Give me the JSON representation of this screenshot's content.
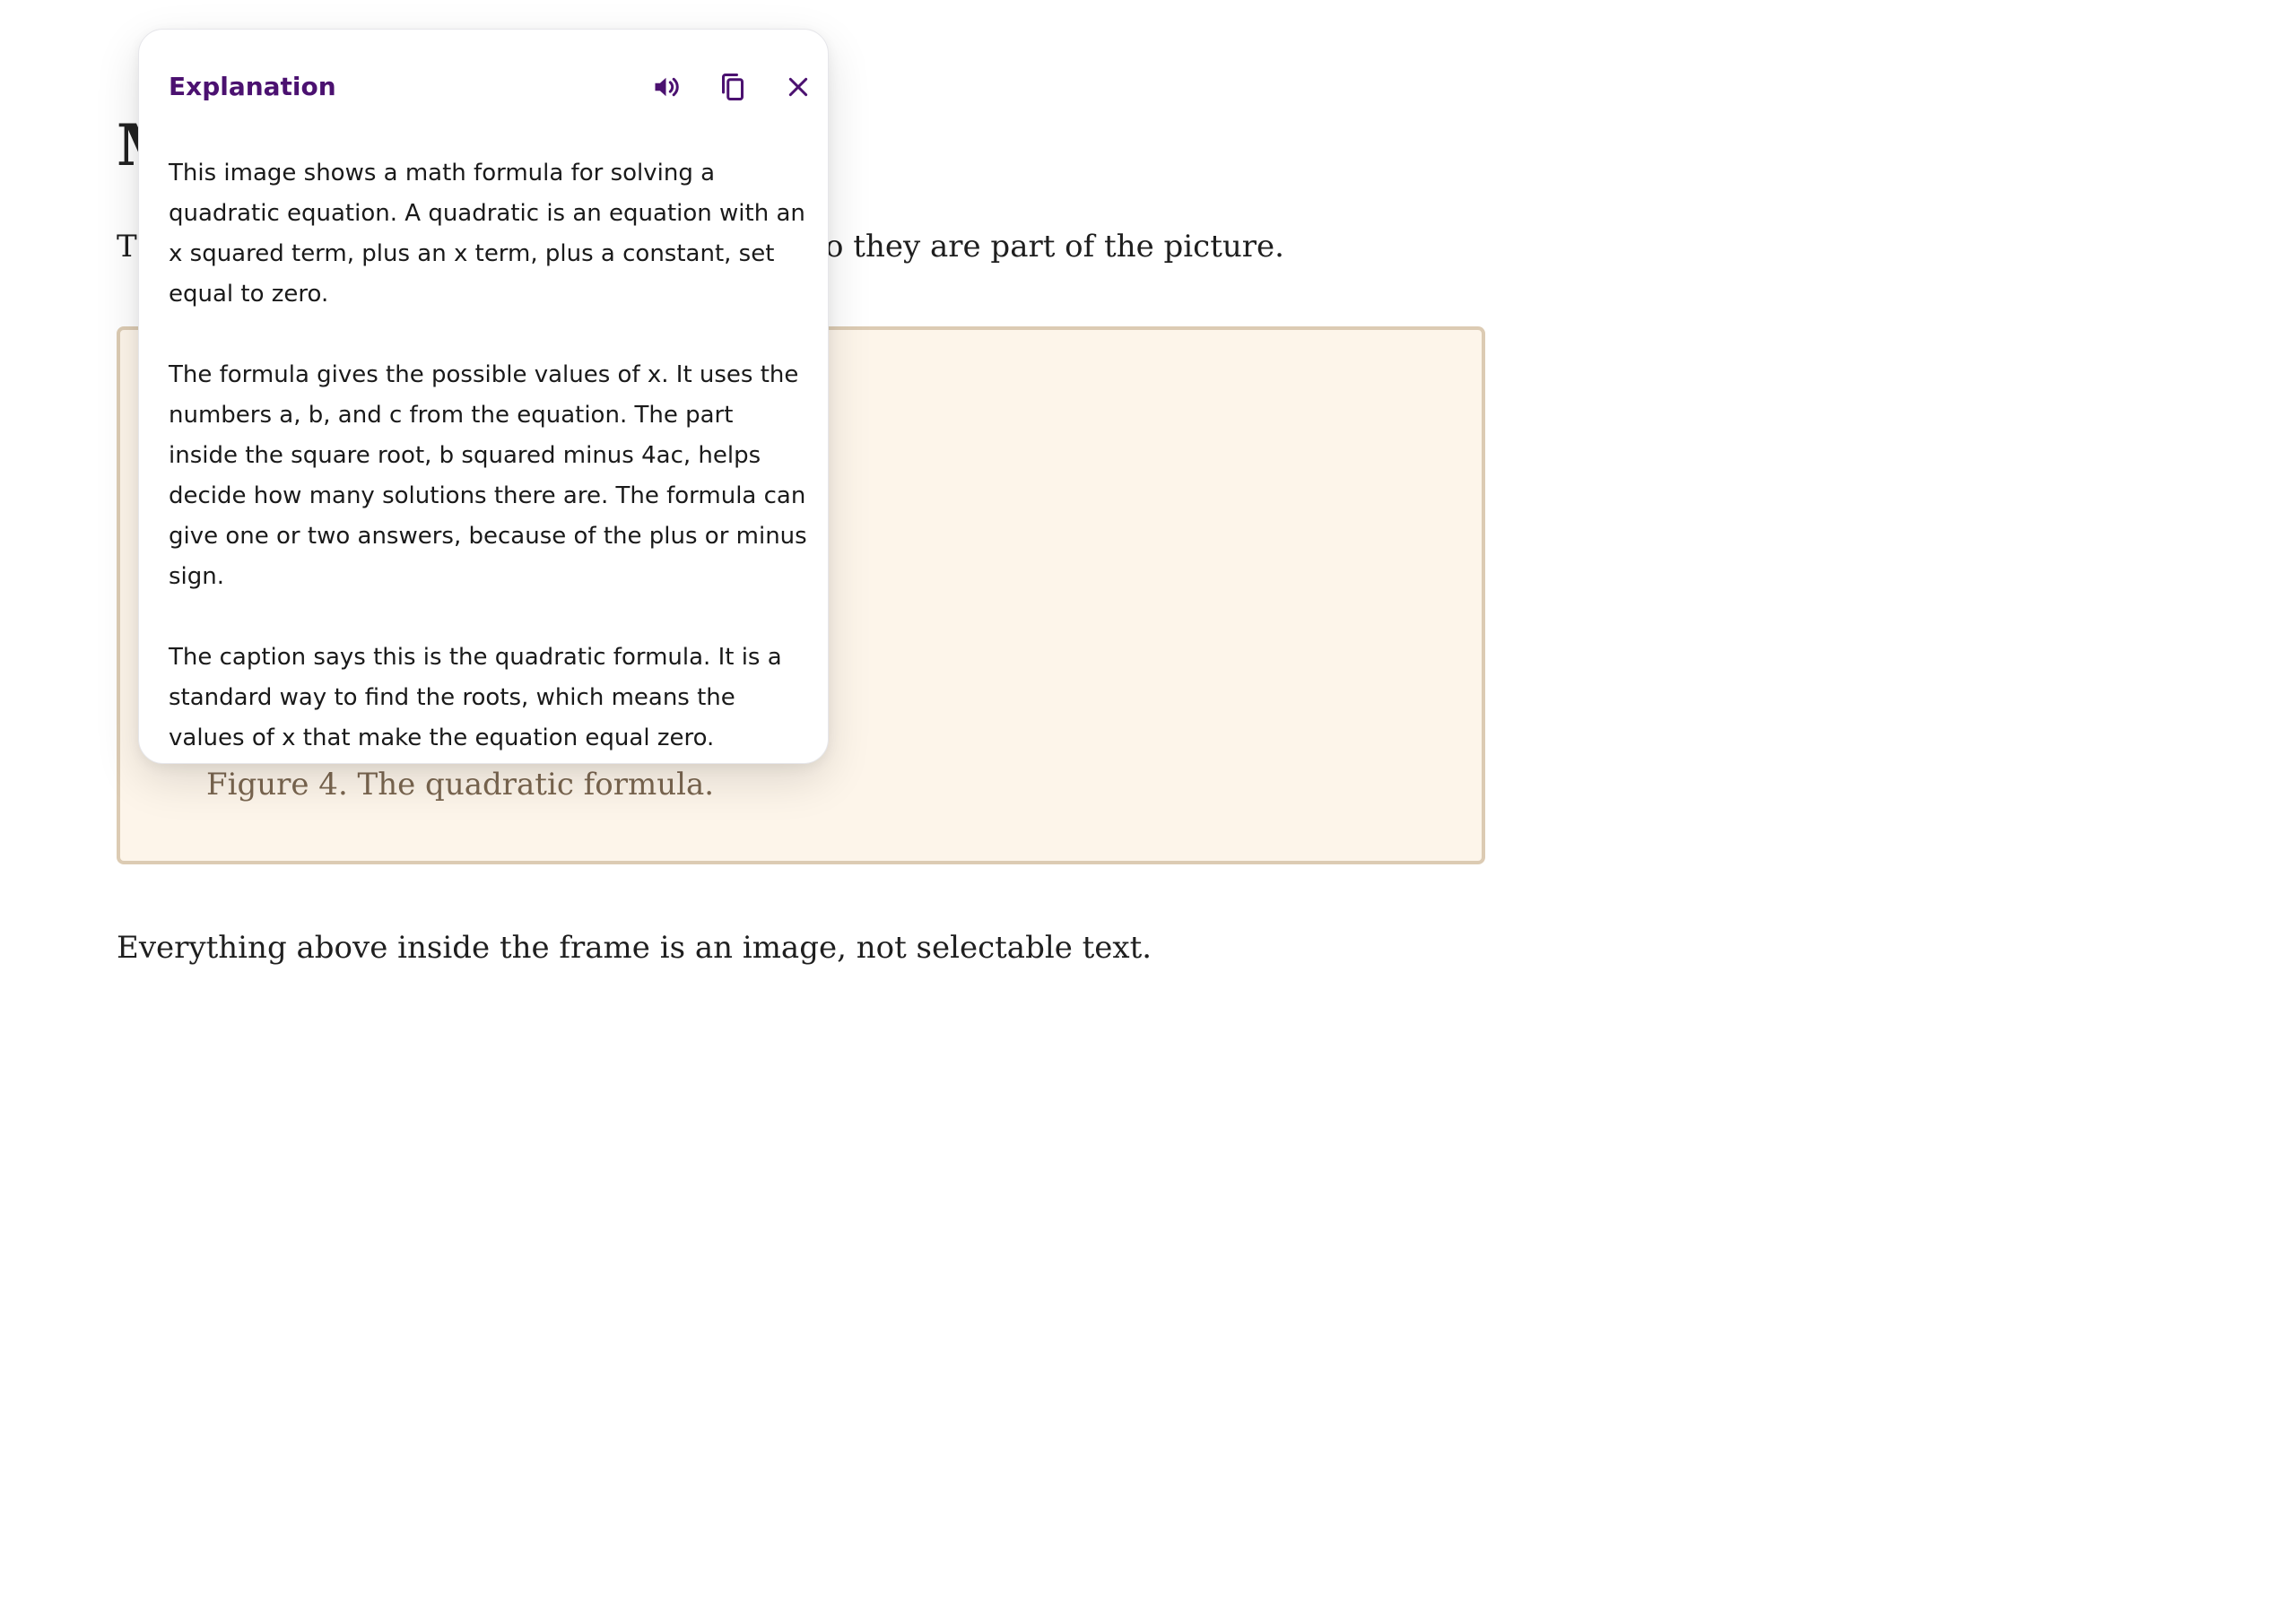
{
  "page": {
    "heading": "M",
    "intro_start": "T",
    "intro_end": "o they are part of the picture.",
    "figure_caption": "Figure 4. The quadratic formula.",
    "footer_note": "Everything above inside the frame is an image, not selectable text."
  },
  "popover": {
    "title": "Explanation",
    "speak_icon": "speaker-icon",
    "copy_icon": "copy-icon",
    "close_icon": "close-icon",
    "accent_color": "#4b1170",
    "paragraphs": [
      "This image shows a math formula for solving a quadratic equation. A quadratic is an equation with an x squared term, plus an x term, plus a constant, set equal to zero.",
      "The formula gives the possible values of x. It uses the numbers a, b, and c from the equation. The part inside the square root, b squared minus 4ac, helps decide how many solutions there are. The formula can give one or two answers, because of the plus or minus sign.",
      "The caption says this is the quadratic formula. It is a standard way to find the roots, which means the values of x that make the equation equal zero."
    ]
  },
  "colors": {
    "figure_background": "#fdf5ea",
    "figure_border": "#dccbb3",
    "caption_text": "#7a6650"
  }
}
